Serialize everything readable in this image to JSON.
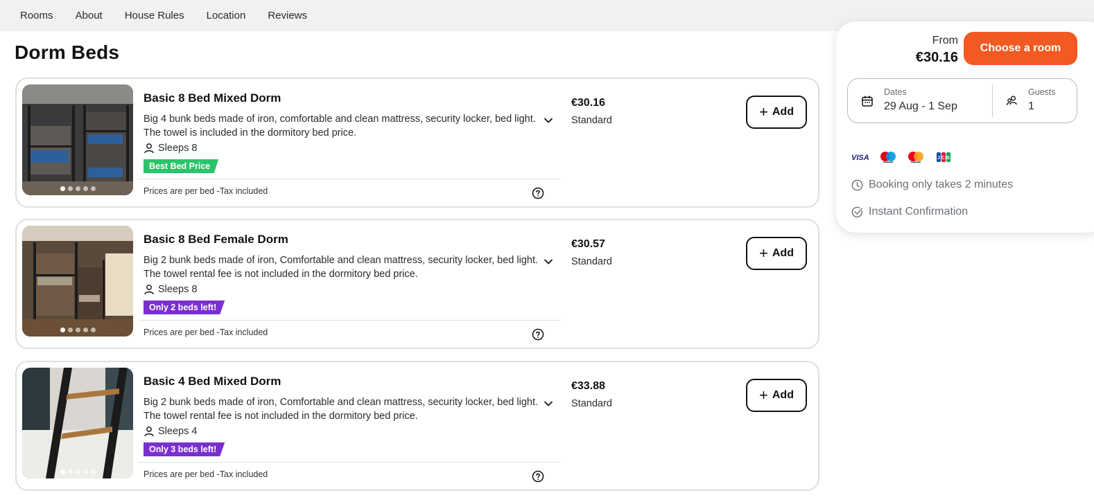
{
  "nav": {
    "items": [
      "Rooms",
      "About",
      "House Rules",
      "Location",
      "Reviews"
    ]
  },
  "section": {
    "title": "Dorm Beds"
  },
  "rooms": [
    {
      "name": "Basic 8 Bed Mixed Dorm",
      "description": "Big 4 bunk beds made of iron, comfortable and clean mattress, security locker, bed light. The towel is included in the dormitory bed price.",
      "sleeps": "Sleeps 8",
      "badge": "Best Bed Price",
      "badge_color": "#2bc46a",
      "footer_note": "Prices are per bed -Tax included",
      "price": "€30.16",
      "rate_type": "Standard",
      "add_label": "Add"
    },
    {
      "name": "Basic 8 Bed Female Dorm",
      "description": "Big 2 bunk beds made of iron, Comfortable and clean mattress, security locker, bed light. The towel rental fee is not included in the dormitory bed price.",
      "sleeps": "Sleeps 8",
      "badge": "Only 2 beds left!",
      "badge_color": "#7a2fd0",
      "footer_note": "Prices are per bed -Tax included",
      "price": "€30.57",
      "rate_type": "Standard",
      "add_label": "Add"
    },
    {
      "name": "Basic 4 Bed Mixed Dorm",
      "description": "Big 2 bunk beds made of iron, Comfortable and clean mattress, security locker, bed light. The towel rental fee is not included in the dormitory bed price.",
      "sleeps": "Sleeps 4",
      "badge": "Only 3 beds left!",
      "badge_color": "#7a2fd0",
      "footer_note": "Prices are per bed -Tax included",
      "price": "€33.88",
      "rate_type": "Standard",
      "add_label": "Add"
    }
  ],
  "booking": {
    "from_label": "From",
    "from_price": "€30.16",
    "choose_label": "Choose a room",
    "choose_color": "#f25a22",
    "dates_label": "Dates",
    "dates_value": "29 Aug - 1 Sep",
    "guests_label": "Guests",
    "guests_value": "1",
    "payment_icons": [
      "visa-icon",
      "maestro-icon",
      "mastercard-icon",
      "jcb-icon"
    ],
    "info_1": "Booking only takes 2 minutes",
    "info_2": "Instant Confirmation"
  }
}
